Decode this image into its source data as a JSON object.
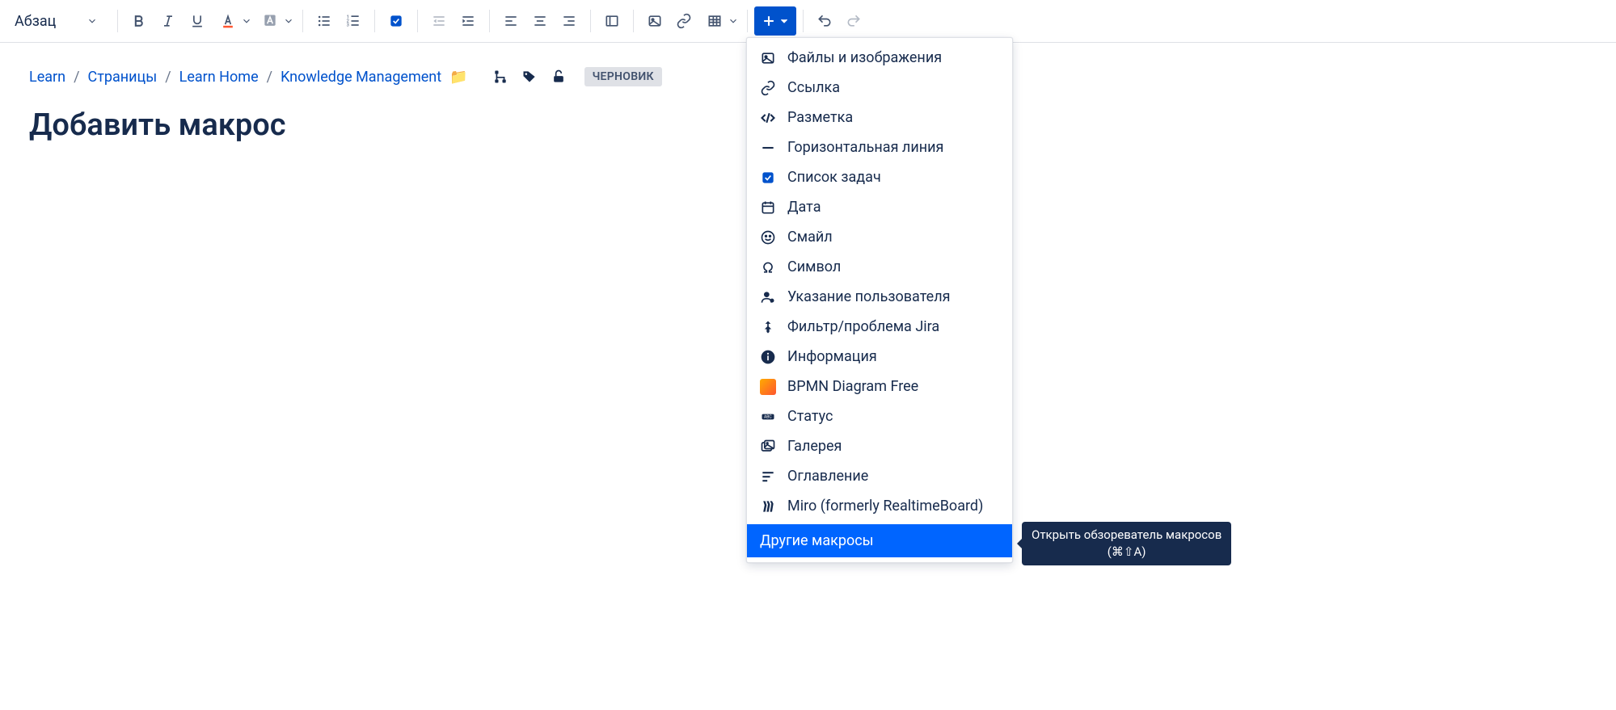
{
  "toolbar": {
    "paragraph_style": "Абзац"
  },
  "breadcrumb": {
    "items": [
      "Learn",
      "Страницы",
      "Learn Home",
      "Knowledge Management"
    ],
    "badge": "ЧЕРНОВИК"
  },
  "page": {
    "title": "Добавить макрос"
  },
  "dropdown": {
    "items": [
      "Файлы и изображения",
      "Ссылка",
      "Разметка",
      "Горизонтальная линия",
      "Список задач",
      "Дата",
      "Смайл",
      "Символ",
      "Указание пользователя",
      "Фильтр/проблема Jira",
      "Информация",
      "BPMN Diagram Free",
      "Статус",
      "Галерея",
      "Оглавление",
      "Miro (formerly RealtimeBoard)"
    ],
    "footer": "Другие макросы"
  },
  "tooltip": {
    "line1": "Открыть обзореватель макросов",
    "line2": "(⌘⇧A)"
  }
}
